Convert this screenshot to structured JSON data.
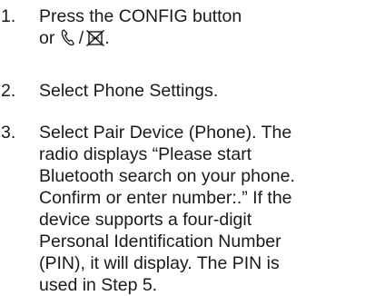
{
  "steps": [
    {
      "number": "1.",
      "line1": "Press the CONFIG button",
      "line2_prefix": "or",
      "line2_separator": "/",
      "line2_suffix": ".",
      "icons": [
        "phone-handset-icon",
        "mute-phone-icon"
      ]
    },
    {
      "number": "2.",
      "text": "Select Phone Settings."
    },
    {
      "number": "3.",
      "lines": [
        "Select Pair Device (Phone). The",
        "radio displays “Please start",
        "Bluetooth search on your phone.",
        "Confirm or enter number:.” If the",
        "device supports a four-digit",
        "Personal Identification Number",
        "(PIN), it will display. The PIN is",
        "used in Step 5."
      ]
    }
  ]
}
